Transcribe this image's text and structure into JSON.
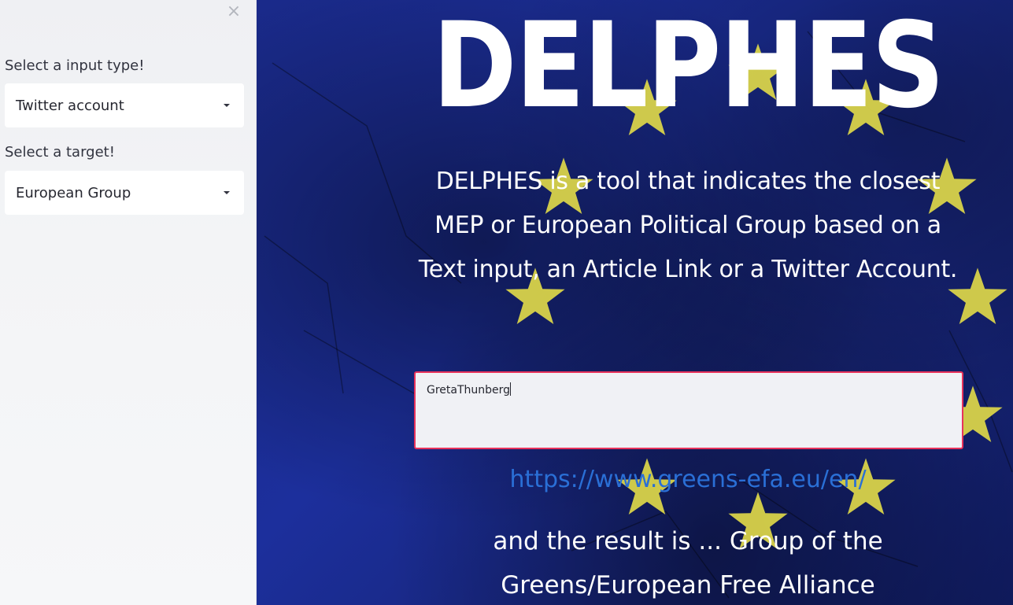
{
  "sidebar": {
    "close_symbol": "×",
    "input_type_label": "Select a input type!",
    "input_type_value": "Twitter account",
    "target_label": "Select a target!",
    "target_value": "European Group"
  },
  "main": {
    "title": "DELPHES",
    "description": "DELPHES is a tool that indicates the closest MEP or European Political Group based on a Text input, an Article Link or a Twitter Account.",
    "input_value": "GretaThunberg",
    "link": "https://www.greens-efa.eu/en/",
    "result_prefix": "and the result is ... ",
    "result_value": "Group of the Greens/European Free Alliance"
  },
  "colors": {
    "flag_blue": "#1c2f9c",
    "star_yellow": "#e8e04a",
    "input_border": "#e8325b",
    "link": "#2a6fd6"
  }
}
